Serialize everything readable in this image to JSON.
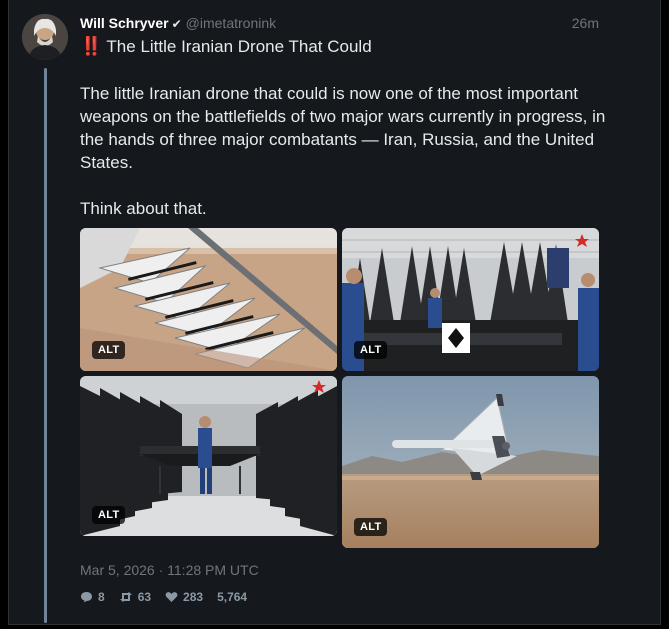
{
  "author": {
    "name": "Will Schryver",
    "handle": "@imetatronink",
    "verified_icon": "checkmark-icon"
  },
  "timestamp_relative": "26m",
  "title_marker": "‼️",
  "title": "The Little Iranian Drone That Could",
  "body": [
    "The little Iranian drone that could is now one of the most important weapons on the battlefields of two major wars currently in progress, in the hands of three major combatants — Iran, Russia, and the United States.",
    "Think about that."
  ],
  "media": {
    "alt_label": "ALT",
    "images": [
      {
        "icon": "drone-launcher-image"
      },
      {
        "icon": "factory-drones-image"
      },
      {
        "icon": "assembly-line-image"
      },
      {
        "icon": "drone-in-flight-image"
      }
    ]
  },
  "posted_at": "Mar 5, 2026 · 11:28 PM UTC",
  "stats": {
    "replies": "8",
    "reposts": "63",
    "likes": "283",
    "views": "5,764"
  },
  "colors": {
    "background": "#15181c",
    "accent_red": "#f4212e",
    "thread_line": "#71839b",
    "muted": "#6e767d"
  }
}
